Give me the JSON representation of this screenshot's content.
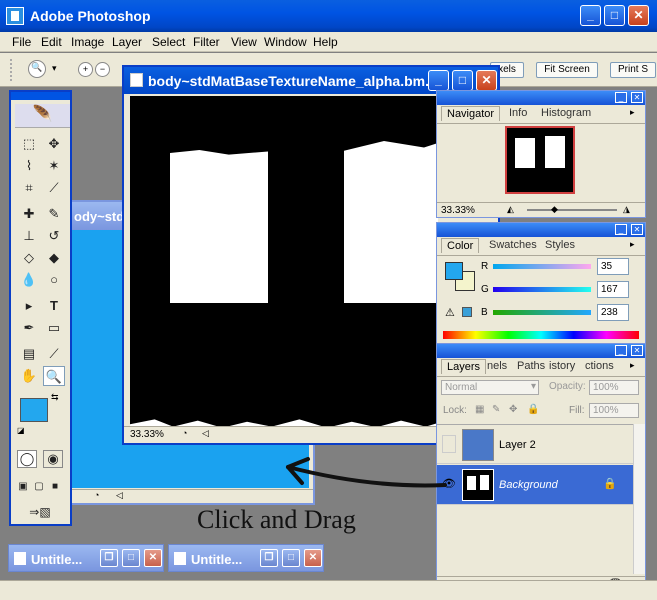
{
  "app": {
    "title": "Adobe Photoshop"
  },
  "menu": [
    "File",
    "Edit",
    "Image",
    "Layer",
    "Select",
    "Filter",
    "View",
    "Window",
    "Help"
  ],
  "options_bar": {
    "actual_pixels_label": "xels",
    "fit_screen_label": "Fit Screen",
    "print_size_label": "Print S"
  },
  "document": {
    "title": "body~stdMatBaseTextureName_alpha.bm...",
    "zoom": "33.33%"
  },
  "background_window": {
    "title": "ody~std"
  },
  "navigator": {
    "tabs": [
      "Navigator",
      "Info",
      "Histogram"
    ],
    "zoom": "33.33%"
  },
  "color": {
    "tabs": [
      "Color",
      "Swatches",
      "Styles"
    ],
    "r_label": "R",
    "g_label": "G",
    "b_label": "B",
    "r": "35",
    "g": "167",
    "b": "238",
    "foreground": "#23a7ee",
    "background": "#f4f4cc"
  },
  "layers": {
    "tabs": [
      "Layers",
      "nels",
      "Paths",
      "istory",
      "ctions"
    ],
    "blend_mode": "Normal",
    "opacity_label": "Opacity:",
    "opacity": "100%",
    "lock_label": "Lock:",
    "fill_label": "Fill:",
    "fill": "100%",
    "items": [
      {
        "name": "Layer 2",
        "visible": false,
        "selected": false
      },
      {
        "name": "Background",
        "visible": true,
        "selected": true
      }
    ]
  },
  "minimized": [
    {
      "title": "Untitle..."
    },
    {
      "title": "Untitle..."
    }
  ],
  "caption": "Click and Drag"
}
